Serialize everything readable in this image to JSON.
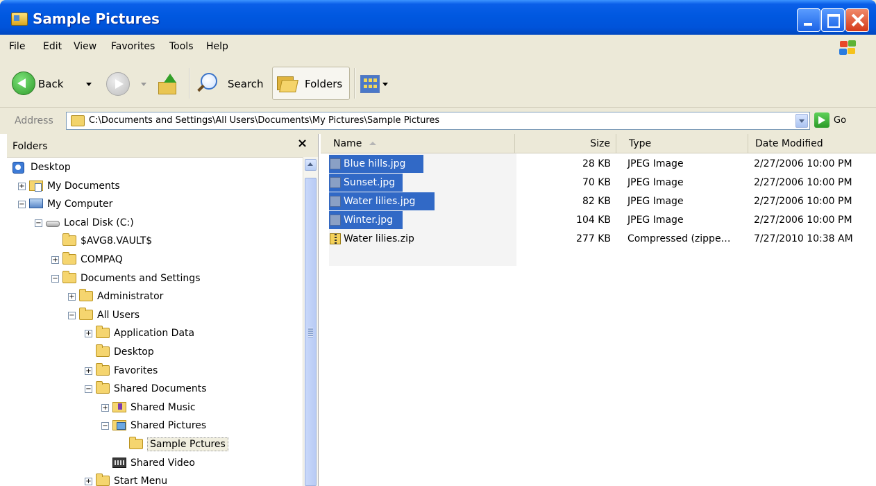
{
  "window": {
    "title": "Sample Pictures"
  },
  "menu": [
    "File",
    "Edit",
    "View",
    "Favorites",
    "Tools",
    "Help"
  ],
  "toolbar": {
    "back_label": "Back",
    "search_label": "Search",
    "folders_label": "Folders"
  },
  "address": {
    "label": "Address",
    "path": "C:\\Documents and Settings\\All Users\\Documents\\My Pictures\\Sample Pictures",
    "go_label": "Go"
  },
  "folders_pane": {
    "title": "Folders",
    "close_glyph": "×",
    "tree": [
      {
        "label": "Desktop",
        "icon": "desktop-icon",
        "depth": 0,
        "expander": ""
      },
      {
        "label": "My Documents",
        "icon": "my-documents-icon",
        "depth": 1,
        "expander": "+"
      },
      {
        "label": "My Computer",
        "icon": "my-computer-icon",
        "depth": 1,
        "expander": "−"
      },
      {
        "label": "Local Disk (C:)",
        "icon": "local-disk-icon",
        "depth": 2,
        "expander": "−"
      },
      {
        "label": "$AVG8.VAULT$",
        "icon": "folder-icon",
        "depth": 3,
        "expander": ""
      },
      {
        "label": "COMPAQ",
        "icon": "folder-icon",
        "depth": 3,
        "expander": "+"
      },
      {
        "label": "Documents and Settings",
        "icon": "folder-icon",
        "depth": 3,
        "expander": "−"
      },
      {
        "label": "Administrator",
        "icon": "folder-icon",
        "depth": 4,
        "expander": "+"
      },
      {
        "label": "All Users",
        "icon": "folder-icon",
        "depth": 4,
        "expander": "−"
      },
      {
        "label": "Application Data",
        "icon": "folder-icon",
        "depth": 5,
        "expander": "+"
      },
      {
        "label": "Desktop",
        "icon": "folder-icon",
        "depth": 5,
        "expander": ""
      },
      {
        "label": "Favorites",
        "icon": "folder-icon",
        "depth": 5,
        "expander": "+"
      },
      {
        "label": "Shared Documents",
        "icon": "folder-icon",
        "depth": 5,
        "expander": "−"
      },
      {
        "label": "Shared Music",
        "icon": "shared-music-icon",
        "depth": 6,
        "expander": "+"
      },
      {
        "label": "Shared Pictures",
        "icon": "shared-pictures-icon",
        "depth": 6,
        "expander": "−"
      },
      {
        "label": "Sample Pctures",
        "icon": "folder-icon",
        "depth": 7,
        "expander": "",
        "selected": true
      },
      {
        "label": "Shared Video",
        "icon": "shared-video-icon",
        "depth": 6,
        "expander": ""
      },
      {
        "label": "Start Menu",
        "icon": "folder-icon",
        "depth": 5,
        "expander": "+"
      }
    ]
  },
  "files": {
    "columns": [
      "Name",
      "Size",
      "Type",
      "Date Modified"
    ],
    "rows": [
      {
        "name": "Blue hills.jpg",
        "size": "28 KB",
        "type": "JPEG Image",
        "date": "2/27/2006 10:00 PM",
        "icon": "jpeg-file-icon",
        "selected": true
      },
      {
        "name": "Sunset.jpg",
        "size": "70 KB",
        "type": "JPEG Image",
        "date": "2/27/2006 10:00 PM",
        "icon": "jpeg-file-icon",
        "selected": true
      },
      {
        "name": "Water lilies.jpg",
        "size": "82 KB",
        "type": "JPEG Image",
        "date": "2/27/2006 10:00 PM",
        "icon": "jpeg-file-icon",
        "selected": true
      },
      {
        "name": "Winter.jpg",
        "size": "104 KB",
        "type": "JPEG Image",
        "date": "2/27/2006 10:00 PM",
        "icon": "jpeg-file-icon",
        "selected": true
      },
      {
        "name": "Water lilies.zip",
        "size": "277 KB",
        "type": "Compressed (zippe…",
        "date": "7/27/2010 10:38 AM",
        "icon": "zip-file-icon",
        "selected": false
      }
    ]
  },
  "colors": {
    "title_bar": "#0058e0",
    "selection": "#3169c6",
    "chrome": "#ece9d8"
  }
}
